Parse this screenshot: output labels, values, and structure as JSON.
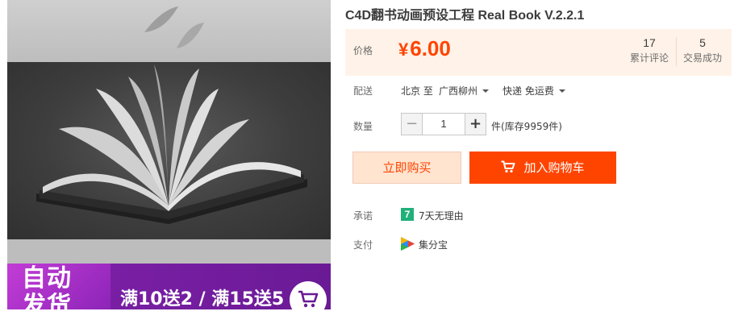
{
  "product": {
    "title": "C4D翻书动画预设工程 Real Book V.2.2.1",
    "image": {
      "promo_line1": "自动",
      "promo_line2": "发货",
      "promo_deal": "满10送2 / 满15送5",
      "banner_colors": {
        "left": "#b030cc",
        "right": "#6a1a95"
      }
    }
  },
  "price": {
    "label": "价格",
    "currency": "¥",
    "amount": "6.00",
    "color": "#ff4400"
  },
  "stats": {
    "reviews_count": "17",
    "reviews_label": "累计评论",
    "sold_count": "5",
    "sold_label": "交易成功"
  },
  "shipping": {
    "label": "配送",
    "from": "北京 至",
    "to": "广西柳州",
    "method": "快递 免运费"
  },
  "quantity": {
    "label": "数量",
    "minus": "−",
    "value": "1",
    "plus": "+",
    "stock_note": "件(库存9959件)"
  },
  "actions": {
    "buy_now": "立即购买",
    "add_to_cart": "加入购物车",
    "accent": "#ff4400"
  },
  "promise": {
    "label": "承诺",
    "badge": "7",
    "text": "7天无理由"
  },
  "payment": {
    "label": "支付",
    "method": "集分宝",
    "icon": "jifenbao-icon"
  }
}
